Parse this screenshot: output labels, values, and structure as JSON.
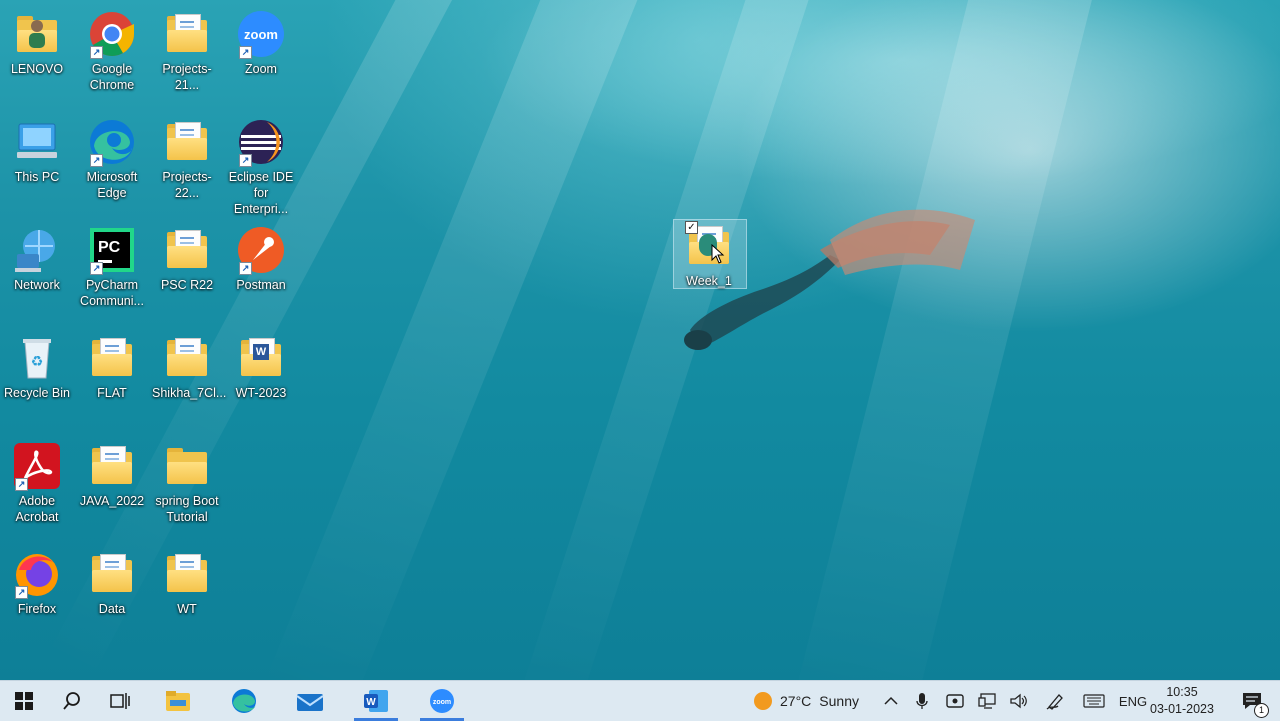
{
  "desktop": {
    "icons": [
      {
        "label": "LENOVO",
        "icon": "user-folder-icon"
      },
      {
        "label": "Google Chrome",
        "icon": "chrome-icon",
        "shortcut": true
      },
      {
        "label": "Projects-21...",
        "icon": "folder-icon"
      },
      {
        "label": "Zoom",
        "icon": "zoom-icon",
        "shortcut": true
      },
      {
        "label": "This PC",
        "icon": "this-pc-icon"
      },
      {
        "label": "Microsoft Edge",
        "icon": "edge-icon",
        "shortcut": true
      },
      {
        "label": "Projects-22...",
        "icon": "folder-icon"
      },
      {
        "label": "Eclipse IDE for Enterpri...",
        "icon": "eclipse-icon",
        "shortcut": true
      },
      {
        "label": "Network",
        "icon": "network-icon"
      },
      {
        "label": "PyCharm Communi...",
        "icon": "pycharm-icon",
        "shortcut": true
      },
      {
        "label": "PSC R22",
        "icon": "folder-icon"
      },
      {
        "label": "Postman",
        "icon": "postman-icon",
        "shortcut": true
      },
      {
        "label": "Recycle Bin",
        "icon": "recycle-bin-icon"
      },
      {
        "label": "FLAT",
        "icon": "folder-icon"
      },
      {
        "label": "Shikha_7Cl...",
        "icon": "folder-icon"
      },
      {
        "label": "WT-2023",
        "icon": "word-folder-icon"
      },
      {
        "label": "Adobe Acrobat",
        "icon": "acrobat-icon",
        "shortcut": true
      },
      {
        "label": "JAVA_2022",
        "icon": "folder-icon"
      },
      {
        "label": "spring Boot Tutorial",
        "icon": "folder-icon"
      },
      {
        "label": "Firefox",
        "icon": "firefox-icon",
        "shortcut": true
      },
      {
        "label": "Data",
        "icon": "folder-icon"
      },
      {
        "label": "WT",
        "icon": "folder-icon"
      }
    ],
    "selected_icon": {
      "label": "Week_1",
      "icon": "folder-icon",
      "checked": true
    }
  },
  "taskbar": {
    "start": "windows-start-icon",
    "search": "search-icon",
    "task_view": "task-view-icon",
    "apps": [
      {
        "name": "File Explorer",
        "icon": "file-explorer-icon"
      },
      {
        "name": "Microsoft Edge",
        "icon": "edge-icon"
      },
      {
        "name": "Mail",
        "icon": "mail-icon"
      },
      {
        "name": "Word",
        "icon": "word-icon",
        "active": true
      },
      {
        "name": "Zoom",
        "icon": "zoom-icon",
        "active": true
      }
    ],
    "weather": {
      "temp": "27°C",
      "condition": "Sunny"
    },
    "language": "ENG",
    "clock": {
      "time": "10:35",
      "date": "03-01-2023"
    },
    "notifications_count": "1",
    "colors": {
      "accent": "#3b7ddd",
      "taskbar_bg": "#dde9f2"
    }
  }
}
